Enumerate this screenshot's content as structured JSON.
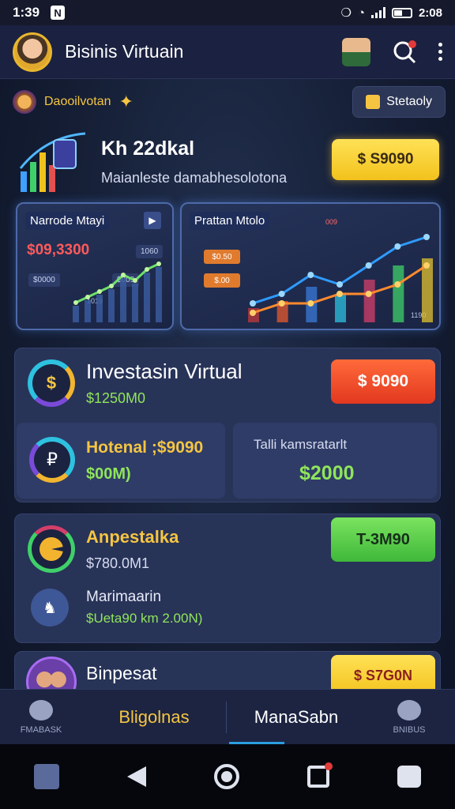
{
  "status_bar": {
    "time": "1:39",
    "network_badge": "N",
    "right_time": "2:08"
  },
  "header": {
    "title": "Bisinis Virtuain"
  },
  "top_chip": {
    "label": "Daooilvotan"
  },
  "stat_button": {
    "label": "Stetaoly"
  },
  "promo": {
    "title": "Kh 22dkal",
    "subtitle": "Maianleste damabhesolotona",
    "button_label": "$ S9090"
  },
  "chart_left": {
    "title": "Narrode Mtayi",
    "value": "$09,3300",
    "chips": [
      "1060",
      "$0000",
      "$009"
    ],
    "tiny_label": "1019"
  },
  "chart_right": {
    "title": "Prattan Mtolo",
    "chips": [
      "$0.50",
      "$.00"
    ],
    "tiny_top": "009",
    "tiny_bottom": "1190"
  },
  "card_invest": {
    "title": "Investasin Virtual",
    "subtitle": "$1250M0",
    "button_label": "$ 9090",
    "sub_a": {
      "title": "Hotenal ;$9090",
      "value": "$00M)"
    },
    "sub_b": {
      "title": "Talli kamsratarlt",
      "value": "$2000"
    }
  },
  "card_2": {
    "title": "Anpestalka",
    "subtitle": "$780.0M1",
    "button_label": "T-3M90",
    "bottom_title": "Marimaarin",
    "bottom_sub": "$Ueta90 km 2.00N)"
  },
  "card_3": {
    "title": "Binpesat",
    "button_label": "$ S7G0N"
  },
  "bottom_nav": {
    "left": "FMABASK",
    "active": "Bligolnas",
    "middle": "ManaSabn",
    "right": "BNIBUS"
  },
  "chart_data": [
    {
      "type": "bar",
      "values": [
        3,
        4,
        5,
        6,
        8,
        7,
        9,
        10
      ]
    },
    {
      "type": "line",
      "series": [
        {
          "values": [
            2,
            3,
            5,
            4,
            6,
            8,
            9
          ]
        },
        {
          "values": [
            1,
            2,
            2,
            3,
            3,
            4,
            6
          ]
        }
      ]
    }
  ]
}
